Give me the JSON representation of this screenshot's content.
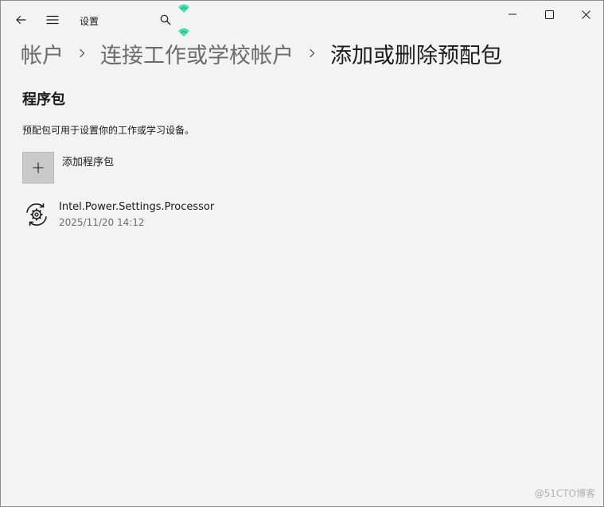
{
  "titlebar": {
    "app_title": "设置",
    "back_icon": "back-arrow-icon",
    "menu_icon": "hamburger-menu-icon",
    "search_icon": "search-icon",
    "window_controls": [
      "minimize-icon",
      "maximize-icon",
      "close-icon"
    ]
  },
  "breadcrumb": {
    "items": [
      "帐户",
      "连接工作或学校帐户",
      "添加或删除预配包"
    ]
  },
  "page": {
    "section_title": "程序包",
    "description": "预配包可用于设置你的工作或学习设备。",
    "add_package_label": "添加程序包",
    "packages": [
      {
        "name": "Intel.Power.Settings.Processor",
        "date": "2025/11/20 14:12",
        "icon": "gear-sync-icon"
      }
    ]
  },
  "watermark": "@51CTO博客",
  "colors": {
    "background": "#f3f3f3",
    "text_primary": "#1a1a1a",
    "text_secondary": "#6b6b6b",
    "add_tile": "#c9c9c9",
    "accent_wifi": "#3fe0b0"
  }
}
